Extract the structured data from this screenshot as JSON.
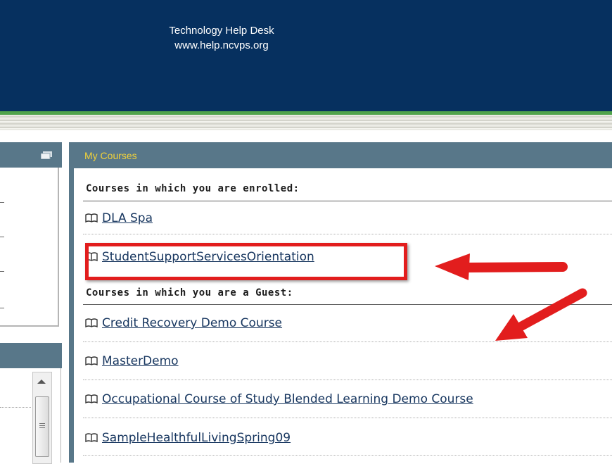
{
  "header": {
    "line1": "Technology Help Desk",
    "line2": "www.help.ncvps.org",
    "bg_color": "#06305f"
  },
  "my_courses": {
    "title": "My Courses",
    "enrolled_heading": "Courses in which you are enrolled:",
    "enrolled": [
      {
        "name": "DLA Spa"
      },
      {
        "name": "StudentSupportServicesOrientation"
      }
    ],
    "guest_heading": "Courses in which you are a Guest:",
    "guest": [
      {
        "name": "Credit Recovery Demo Course"
      },
      {
        "name": "MasterDemo"
      },
      {
        "name": "Occupational Course of Study Blended Learning Demo Course"
      },
      {
        "name": "SampleHealthfulLivingSpring09"
      }
    ]
  },
  "annotations": {
    "highlight_color": "#e21d1d",
    "arrow_color": "#e21d1d"
  },
  "icons": {
    "course": "book-icon",
    "panel": "window-icon"
  }
}
